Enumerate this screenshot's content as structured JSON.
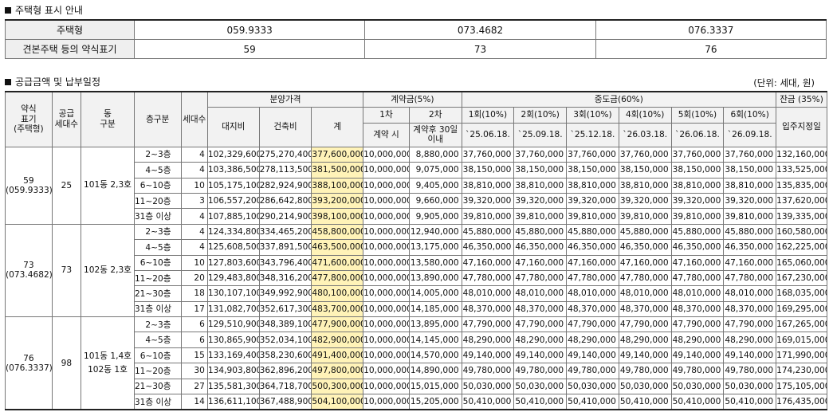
{
  "type_section": {
    "title": "주택형 표시 안내",
    "row_header_1": "주택형",
    "row_header_2": "견본주택 등의 약식표기",
    "types": [
      "059.9333",
      "073.4682",
      "076.3337"
    ],
    "abbr": [
      "59",
      "73",
      "76"
    ]
  },
  "price_section": {
    "title": "공급금액 및 납부일정",
    "unit": "(단위: 세대, 원)"
  },
  "headers": {
    "abbr": "약식\n표기\n(주택형)",
    "supply": "공급\n세대수",
    "dong": "동\n구분",
    "floor": "층구분",
    "households": "세대수",
    "price": "분양가격",
    "land": "대지비",
    "building": "건축비",
    "total": "계",
    "deposit": "계약금(5%)",
    "dep1": "1차",
    "dep1_sub": "계약 시",
    "dep2": "2차",
    "dep2_sub": "계약후 30일 이내",
    "middle": "중도금(60%)",
    "mid_rounds": [
      "1회(10%)",
      "2회(10%)",
      "3회(10%)",
      "4회(10%)",
      "5회(10%)",
      "6회(10%)"
    ],
    "mid_dates": [
      "`25.06.18.",
      "`25.09.18.",
      "`25.12.18.",
      "`26.03.18.",
      "`26.06.18.",
      "`26.09.18."
    ],
    "balance": "잔금 (35%)",
    "balance_sub": "입주지정일"
  },
  "groups": [
    {
      "abbr": "59",
      "type": "(059.9333)",
      "supply": "25",
      "dong": "101동 2,3호",
      "rows": [
        {
          "floor": "2~3층",
          "hh": "4",
          "land": "102,329,600",
          "bld": "275,270,400",
          "total": "377,600,000",
          "d1": "10,000,000",
          "d2": "8,880,000",
          "m": "37,760,000",
          "bal": "132,160,000"
        },
        {
          "floor": "4~5층",
          "hh": "4",
          "land": "103,386,500",
          "bld": "278,113,500",
          "total": "381,500,000",
          "d1": "10,000,000",
          "d2": "9,075,000",
          "m": "38,150,000",
          "bal": "133,525,000"
        },
        {
          "floor": "6~10층",
          "hh": "10",
          "land": "105,175,100",
          "bld": "282,924,900",
          "total": "388,100,000",
          "d1": "10,000,000",
          "d2": "9,405,000",
          "m": "38,810,000",
          "bal": "135,835,000"
        },
        {
          "floor": "11~20층",
          "hh": "3",
          "land": "106,557,200",
          "bld": "286,642,800",
          "total": "393,200,000",
          "d1": "10,000,000",
          "d2": "9,660,000",
          "m": "39,320,000",
          "bal": "137,620,000"
        },
        {
          "floor": "31층 이상",
          "hh": "4",
          "land": "107,885,100",
          "bld": "290,214,900",
          "total": "398,100,000",
          "d1": "10,000,000",
          "d2": "9,905,000",
          "m": "39,810,000",
          "bal": "139,335,000"
        }
      ]
    },
    {
      "abbr": "73",
      "type": "(073.4682)",
      "supply": "73",
      "dong": "102동 2,3호",
      "rows": [
        {
          "floor": "2~3층",
          "hh": "4",
          "land": "124,334,800",
          "bld": "334,465,200",
          "total": "458,800,000",
          "d1": "10,000,000",
          "d2": "12,940,000",
          "m": "45,880,000",
          "bal": "160,580,000"
        },
        {
          "floor": "4~5층",
          "hh": "4",
          "land": "125,608,500",
          "bld": "337,891,500",
          "total": "463,500,000",
          "d1": "10,000,000",
          "d2": "13,175,000",
          "m": "46,350,000",
          "bal": "162,225,000"
        },
        {
          "floor": "6~10층",
          "hh": "10",
          "land": "127,803,600",
          "bld": "343,796,400",
          "total": "471,600,000",
          "d1": "10,000,000",
          "d2": "13,580,000",
          "m": "47,160,000",
          "bal": "165,060,000"
        },
        {
          "floor": "11~20층",
          "hh": "20",
          "land": "129,483,800",
          "bld": "348,316,200",
          "total": "477,800,000",
          "d1": "10,000,000",
          "d2": "13,890,000",
          "m": "47,780,000",
          "bal": "167,230,000"
        },
        {
          "floor": "21~30층",
          "hh": "18",
          "land": "130,107,100",
          "bld": "349,992,900",
          "total": "480,100,000",
          "d1": "10,000,000",
          "d2": "14,005,000",
          "m": "48,010,000",
          "bal": "168,035,000"
        },
        {
          "floor": "31층 이상",
          "hh": "17",
          "land": "131,082,700",
          "bld": "352,617,300",
          "total": "483,700,000",
          "d1": "10,000,000",
          "d2": "14,185,000",
          "m": "48,370,000",
          "bal": "169,295,000"
        }
      ]
    },
    {
      "abbr": "76",
      "type": "(076.3337)",
      "supply": "98",
      "dong": "101동 1,4호\n102동 1호",
      "rows": [
        {
          "floor": "2~3층",
          "hh": "6",
          "land": "129,510,900",
          "bld": "348,389,100",
          "total": "477,900,000",
          "d1": "10,000,000",
          "d2": "13,895,000",
          "m": "47,790,000",
          "bal": "167,265,000"
        },
        {
          "floor": "4~5층",
          "hh": "6",
          "land": "130,865,900",
          "bld": "352,034,100",
          "total": "482,900,000",
          "d1": "10,000,000",
          "d2": "14,145,000",
          "m": "48,290,000",
          "bal": "169,015,000"
        },
        {
          "floor": "6~10층",
          "hh": "15",
          "land": "133,169,400",
          "bld": "358,230,600",
          "total": "491,400,000",
          "d1": "10,000,000",
          "d2": "14,570,000",
          "m": "49,140,000",
          "bal": "171,990,000"
        },
        {
          "floor": "11~20층",
          "hh": "30",
          "land": "134,903,800",
          "bld": "362,896,200",
          "total": "497,800,000",
          "d1": "10,000,000",
          "d2": "14,890,000",
          "m": "49,780,000",
          "bal": "174,230,000"
        },
        {
          "floor": "21~30층",
          "hh": "27",
          "land": "135,581,300",
          "bld": "364,718,700",
          "total": "500,300,000",
          "d1": "10,000,000",
          "d2": "15,015,000",
          "m": "50,030,000",
          "bal": "175,105,000"
        },
        {
          "floor": "31층 이상",
          "hh": "14",
          "land": "136,611,100",
          "bld": "367,488,900",
          "total": "504,100,000",
          "d1": "10,000,000",
          "d2": "15,205,000",
          "m": "50,410,000",
          "bal": "176,435,000"
        }
      ]
    }
  ]
}
